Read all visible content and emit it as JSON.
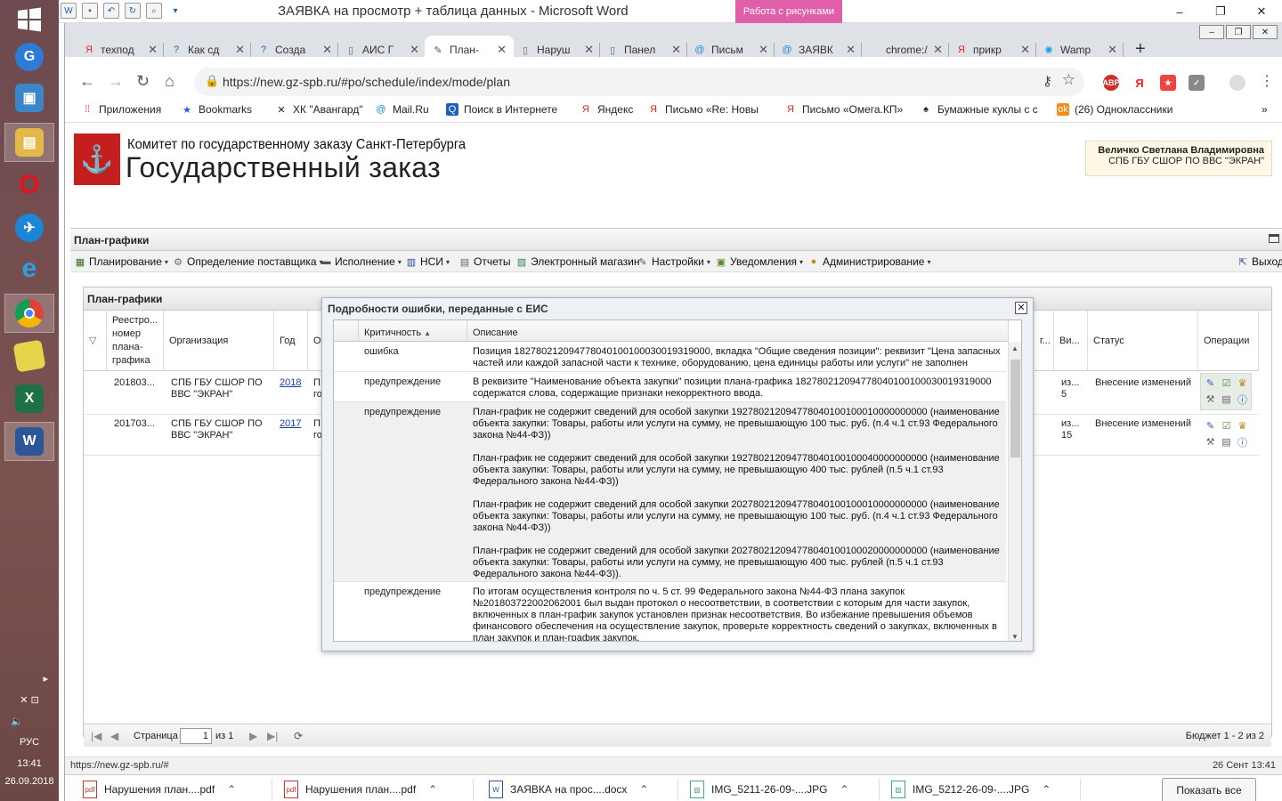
{
  "window": {
    "title": "ЗАЯВКА на просмотр + таблица данных  -  Microsoft Word",
    "context_tab": "Работа с рисунками"
  },
  "taskbar": {
    "language": "РУС",
    "time": "13:41",
    "date": "26.09.2018"
  },
  "tabs": [
    {
      "label": "техпод",
      "icon": "yandex-icon"
    },
    {
      "label": "Как сд",
      "icon": "help-icon"
    },
    {
      "label": "Созда",
      "icon": "help-icon"
    },
    {
      "label": "АИС Г",
      "icon": "page-icon"
    },
    {
      "label": "План-",
      "icon": "wrench-icon"
    },
    {
      "label": "Наруш",
      "icon": "page-icon"
    },
    {
      "label": "Панел",
      "icon": "page-icon"
    },
    {
      "label": "Письм",
      "icon": "mail-icon"
    },
    {
      "label": "ЗАЯВК",
      "icon": "mail-icon"
    },
    {
      "label": "chrome://n",
      "icon": "none"
    },
    {
      "label": "прикр",
      "icon": "yandex-icon"
    },
    {
      "label": "Wamp",
      "icon": "wamp-icon"
    }
  ],
  "address": {
    "url": "https://new.gz-spb.ru/#po/schedule/index/mode/plan"
  },
  "bookmarks": [
    "Приложения",
    "Bookmarks",
    "ХК \"Авангард\"",
    "Mail.Ru",
    "Поиск в Интернете",
    "Яндекс",
    "Письмо «Re: Новы",
    "Письмо «Омега.КП»",
    "Бумажные куклы с с",
    "(26) Одноклассники"
  ],
  "header": {
    "committee": "Комитет по государственному заказу Санкт-Петербурга",
    "title": "Государственный заказ",
    "user_name": "Величко Светлана Владимировна",
    "user_org": "СПБ ГБУ СШОР ПО ВВС \"ЭКРАН\""
  },
  "panel": {
    "title": "План-графики"
  },
  "menu": [
    "Планирование",
    "Определение поставщика",
    "Исполнение",
    "НСИ",
    "Отчеты",
    "Электронный магазин",
    "Настройки",
    "Уведомления",
    "Администрирование"
  ],
  "menu_exit": "Выход",
  "grid": {
    "title": "План-графики",
    "columns": {
      "reg": "Реестро... номер плана-графика",
      "org": "Организация",
      "year": "Год",
      "cut": "О",
      "vi": "Ви...",
      "status": "Статус",
      "ops": "Операции",
      "pcol": "г..."
    },
    "rows": [
      {
        "reg": "201803...",
        "org": "СПБ ГБУ СШОР ПО ВВС \"ЭКРАН\"",
        "year": "2018",
        "p": "П.",
        "p2": "го",
        "vi": "из... 5",
        "status": "Внесение изменений"
      },
      {
        "reg": "201703...",
        "org": "СПБ ГБУ СШОР ПО ВВС \"ЭКРАН\"",
        "year": "2017",
        "p": "П.",
        "p2": "го",
        "vi": "из... 15",
        "status": "Внесение изменений"
      }
    ]
  },
  "pager": {
    "page_label": "Страница",
    "page": "1",
    "of": "из 1",
    "summary": "Бюджет 1 - 2 из 2"
  },
  "modal": {
    "title": "Подробности ошибки, переданные с ЕИС",
    "col_severity": "Критичность",
    "col_desc": "Описание",
    "rows": [
      {
        "severity": "ошибка",
        "desc": "Позиция 1827802120947780401001000300193190​00, вкладка \"Общие сведения позиции\": реквизит \"Цена запасных частей или каждой запасной части к технике, оборудованию, цена единицы работы или услуги\" не заполнен"
      },
      {
        "severity": "предупреждение",
        "desc": "В реквизите \"Наименование объекта закупки\" позиции плана-графика 182780212094778040100100030019319000 содержатся слова, содержащие признаки некорректного ввода."
      },
      {
        "severity": "предупреждение",
        "desc": "План-график не содержит сведений для особой закупки 192780212094778040100100010000000000 (наименование объекта закупки: Товары, работы или услуги на сумму, не превышающую 100 тыс. руб. (п.4 ч.1 ст.93 Федерального закона №44-ФЗ))\n\nПлан-график не содержит сведений для особой закупки 192780212094778040100100040000000000 (наименование объекта закупки: Товары, работы или услуги на сумму, не превышающую 400 тыс. рублей (п.5 ч.1 ст.93 Федерального закона №44-ФЗ))\n\nПлан-график не содержит сведений для особой закупки 202780212094778040100100010000000000 (наименование объекта закупки: Товары, работы или услуги на сумму, не превышающую 100 тыс. руб. (п.4 ч.1 ст.93 Федерального закона №44-ФЗ))\n\nПлан-график не содержит сведений для особой закупки 202780212094778040100100020000000000 (наименование объекта закупки: Товары, работы или услуги на сумму, не превышающую 400 тыс. рублей (п.5 ч.1 ст.93 Федерального закона №44-ФЗ))."
      },
      {
        "severity": "предупреждение",
        "desc": "По итогам осуществления контроля по ч. 5 ст. 99 Федерального закона №44-ФЗ плана закупок №201803722002062001 был выдан протокол о несоответствии, в соответствии с которым для части закупок, включенных в план-график закупок установлен признак несоответствия. Во избежание превышения объемов финансового обеспечения на осуществление закупок, проверьте корректность сведений о закупках, включенных в план закупок и план-график закупок."
      }
    ]
  },
  "statusbar": {
    "url": "https://new.gz-spb.ru/#",
    "date": "26 Сент 13:41"
  },
  "downloads": [
    "Нарушения план....pdf",
    "Нарушения план....pdf",
    "ЗАЯВКА на прос....docx",
    "IMG_5211-26-09-....JPG",
    "IMG_5212-26-09-....JPG"
  ],
  "downloads_show_all": "Показать все"
}
